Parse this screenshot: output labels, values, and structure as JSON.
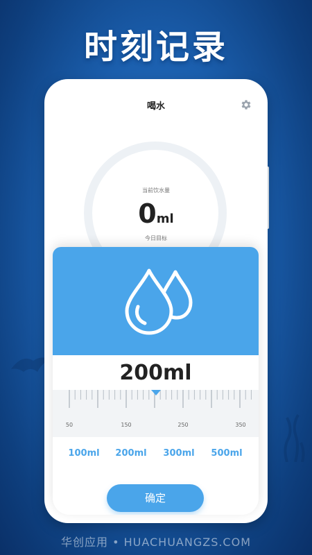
{
  "headline": "时刻记录",
  "app": {
    "title": "喝水",
    "settings_icon": "gear-icon"
  },
  "progress": {
    "current_label": "当前饮水量",
    "current_value": "0",
    "current_unit": "ml",
    "target_label": "今日目标"
  },
  "sheet": {
    "icon": "water-drops-icon",
    "amount": "200ml",
    "ruler_labels": [
      "50",
      "150",
      "250",
      "350"
    ],
    "presets": [
      "100ml",
      "200ml",
      "300ml",
      "500ml"
    ],
    "confirm_label": "确定"
  },
  "watermark": "华创应用 • HUACHUANGZS.COM",
  "colors": {
    "accent": "#4aa5ea",
    "background": "#1b5fae"
  }
}
